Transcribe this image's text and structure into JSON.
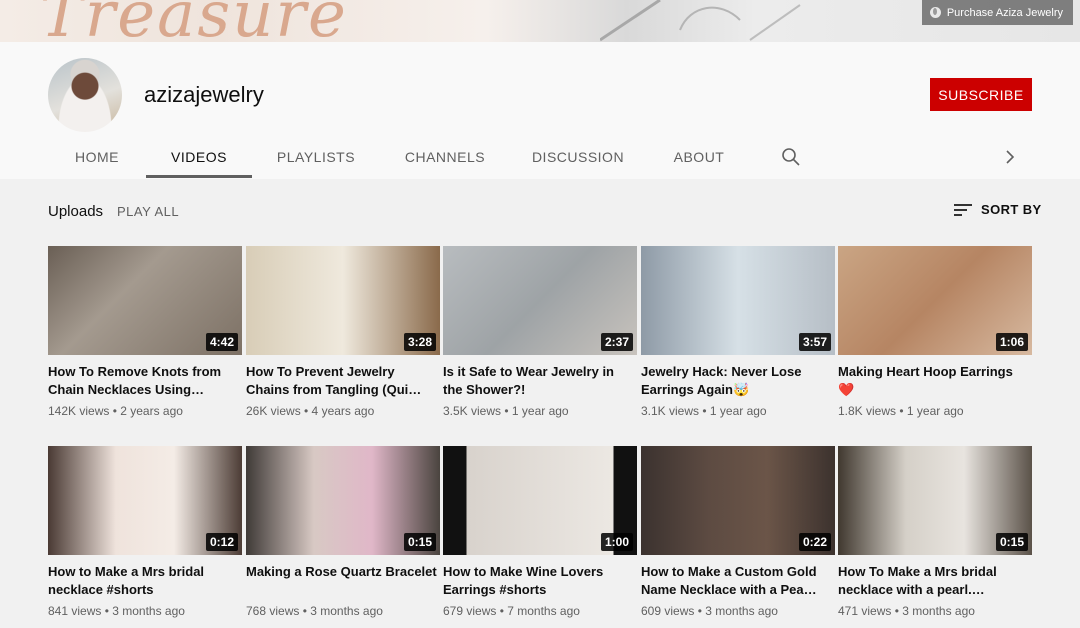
{
  "banner": {
    "script_text": "Treasure",
    "link_label": "Purchase Aziza Jewelry"
  },
  "channel": {
    "name": "azizajewelry",
    "subscribe_label": "SUBSCRIBE"
  },
  "tabs": [
    {
      "label": "HOME"
    },
    {
      "label": "VIDEOS",
      "active": true
    },
    {
      "label": "PLAYLISTS"
    },
    {
      "label": "CHANNELS"
    },
    {
      "label": "DISCUSSION"
    },
    {
      "label": "ABOUT"
    }
  ],
  "uploads": {
    "title": "Uploads",
    "play_all": "PLAY ALL",
    "sort_label": "SORT BY"
  },
  "videos": [
    {
      "title": "How To Remove Knots from Chain Necklaces Using…",
      "duration": "4:42",
      "meta": "142K views • 2 years ago"
    },
    {
      "title": "How To Prevent Jewelry Chains from Tangling (Qui…",
      "duration": "3:28",
      "meta": "26K views • 4 years ago"
    },
    {
      "title": "Is it Safe to Wear Jewelry in the Shower?!",
      "duration": "2:37",
      "meta": "3.5K views • 1 year ago"
    },
    {
      "title": "Jewelry Hack: Never Lose Earrings Again🤯",
      "duration": "3:57",
      "meta": "3.1K views • 1 year ago"
    },
    {
      "title": "Making Heart Hoop Earrings ❤️",
      "duration": "1:06",
      "meta": "1.8K views • 1 year ago"
    },
    {
      "title": "How to Make a Mrs bridal necklace #shorts",
      "duration": "0:12",
      "meta": "841 views • 3 months ago"
    },
    {
      "title": "Making a Rose Quartz Bracelet",
      "duration": "0:15",
      "meta": "768 views • 3 months ago"
    },
    {
      "title": "How to Make Wine Lovers Earrings #shorts",
      "duration": "1:00",
      "meta": "679 views • 7 months ago"
    },
    {
      "title": "How to Make a Custom Gold Name Necklace with a Pea…",
      "duration": "0:22",
      "meta": "609 views • 3 months ago"
    },
    {
      "title": "How To Make a Mrs bridal necklace with a pearl.…",
      "duration": "0:15",
      "meta": "471 views • 3 months ago"
    }
  ],
  "icons": {
    "search": "search-icon",
    "chevron": "chevron-right-icon",
    "sort": "sort-icon",
    "globe": "globe-icon"
  },
  "colors": {
    "subscribe": "#cc0000",
    "text": "#0f0f0f",
    "secondary": "#606060"
  }
}
